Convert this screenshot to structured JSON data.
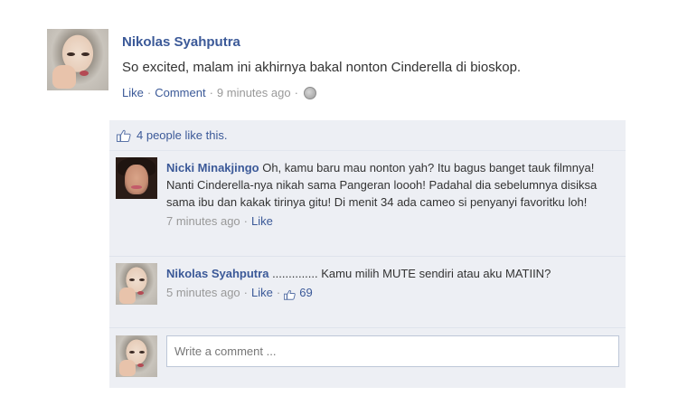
{
  "post": {
    "author": "Nikolas Syahputra",
    "text": "So excited, malam ini akhirnya bakal nonton Cinderella di bioskop.",
    "actions": {
      "like": "Like",
      "comment": "Comment",
      "time": "9 minutes ago",
      "separator": "·"
    }
  },
  "likes": {
    "text": "4 people like this."
  },
  "comments": [
    {
      "author": "Nicki Minakjingo",
      "text": "Oh, kamu baru mau nonton yah? Itu bagus banget tauk filmnya! Nanti Cinderella-nya nikah sama Pangeran loooh! Padahal dia sebelumnya disiksa sama ibu dan kakak tirinya gitu! Di menit 34 ada cameo si penyanyi favoritku loh!",
      "time": "7 minutes ago",
      "like": "Like"
    },
    {
      "author": "Nikolas Syahputra",
      "text": ".............. Kamu milih MUTE sendiri atau aku MATIIN?",
      "time": "5 minutes ago",
      "like": "Like",
      "like_count": "69"
    }
  ],
  "composer": {
    "placeholder": "Write a comment ..."
  },
  "colors": {
    "link": "#3b5998",
    "ufi_background": "#edeff4",
    "meta_text": "#999999"
  },
  "icons": [
    "globe-icon",
    "thumbs-up-icon"
  ]
}
